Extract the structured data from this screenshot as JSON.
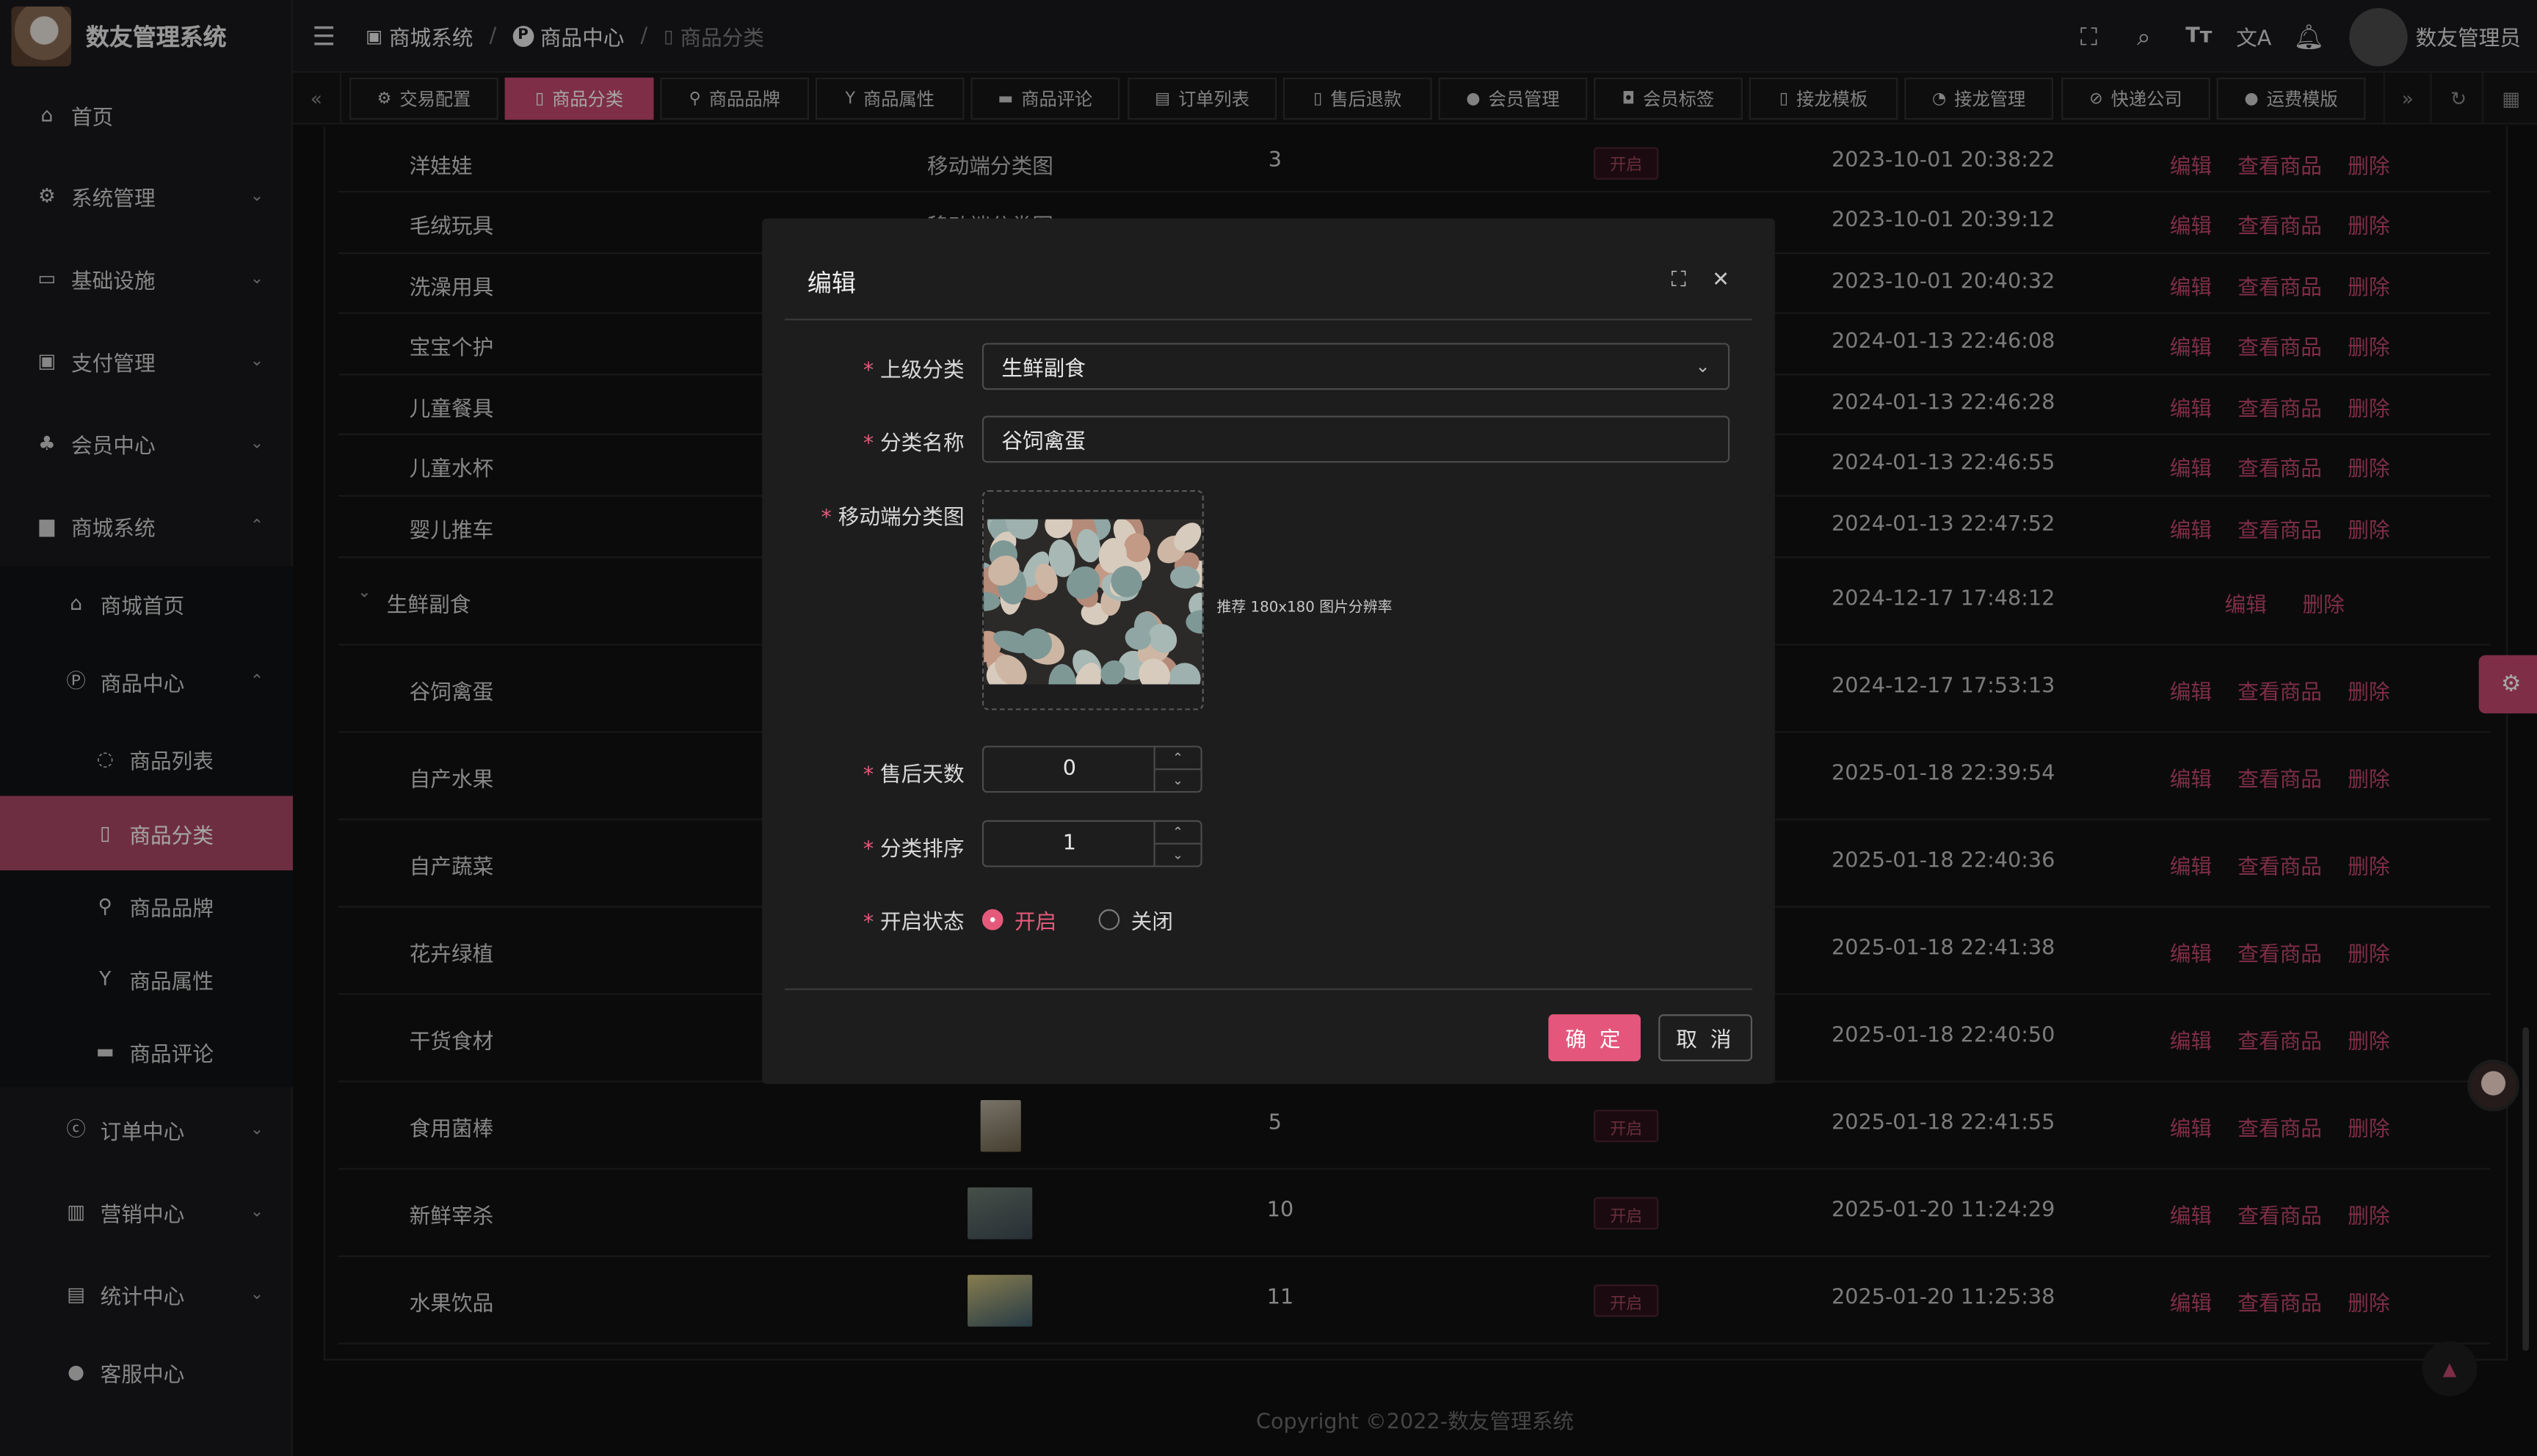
{
  "app": {
    "title": "数友管理系统"
  },
  "sidebar": {
    "items": [
      {
        "label": "首页",
        "icon": "home-icon",
        "arrow": ""
      },
      {
        "label": "系统管理",
        "icon": "gear-icon",
        "arrow": "⌄"
      },
      {
        "label": "基础设施",
        "icon": "monitor-icon",
        "arrow": "⌄"
      },
      {
        "label": "支付管理",
        "icon": "payment-icon",
        "arrow": "⌄"
      },
      {
        "label": "会员中心",
        "icon": "members-icon",
        "arrow": "⌄"
      },
      {
        "label": "商城系统",
        "icon": "shop-icon",
        "arrow": "⌃"
      },
      {
        "label": "商城首页",
        "icon": "home-icon",
        "arrow": ""
      },
      {
        "label": "商品中心",
        "icon": "product-center-icon",
        "arrow": "⌃"
      },
      {
        "label": "商品列表",
        "icon": "list-icon",
        "arrow": ""
      },
      {
        "label": "商品分类",
        "icon": "category-icon",
        "arrow": ""
      },
      {
        "label": "商品品牌",
        "icon": "brand-icon",
        "arrow": ""
      },
      {
        "label": "商品属性",
        "icon": "attribute-icon",
        "arrow": ""
      },
      {
        "label": "商品评论",
        "icon": "comment-icon",
        "arrow": ""
      },
      {
        "label": "订单中心",
        "icon": "order-icon",
        "arrow": "⌄"
      },
      {
        "label": "营销中心",
        "icon": "gift-icon",
        "arrow": "⌄"
      },
      {
        "label": "统计中心",
        "icon": "stats-icon",
        "arrow": "⌄"
      },
      {
        "label": "客服中心",
        "icon": "user-icon",
        "arrow": ""
      }
    ]
  },
  "header": {
    "breadcrumbs": [
      "商城系统",
      "商品中心",
      "商品分类"
    ],
    "separator": "/",
    "username": "数友管理员"
  },
  "tabs": [
    {
      "label": "交易配置"
    },
    {
      "label": "商品分类"
    },
    {
      "label": "商品品牌"
    },
    {
      "label": "商品属性"
    },
    {
      "label": "商品评论"
    },
    {
      "label": "订单列表"
    },
    {
      "label": "售后退款"
    },
    {
      "label": "会员管理"
    },
    {
      "label": "会员标签"
    },
    {
      "label": "接龙模板"
    },
    {
      "label": "接龙管理"
    },
    {
      "label": "快递公司"
    },
    {
      "label": "运费模版"
    }
  ],
  "table": {
    "status_label": "开启",
    "ops": {
      "edit": "编辑",
      "view": "查看商品",
      "delete": "删除"
    },
    "img_alt": "移动端分类图",
    "rows": [
      {
        "name": "洋娃娃",
        "sort": "3",
        "time": "2023-10-01 20:38:22",
        "img": "alt"
      },
      {
        "name": "毛绒玩具",
        "sort": "",
        "time": "2023-10-01 20:39:12",
        "img": "alt"
      },
      {
        "name": "洗澡用具",
        "sort": "",
        "time": "2023-10-01 20:40:32",
        "img": ""
      },
      {
        "name": "宝宝个护",
        "sort": "",
        "time": "2024-01-13 22:46:08",
        "img": ""
      },
      {
        "name": "儿童餐具",
        "sort": "",
        "time": "2024-01-13 22:46:28",
        "img": ""
      },
      {
        "name": "儿童水杯",
        "sort": "",
        "time": "2024-01-13 22:46:55",
        "img": ""
      },
      {
        "name": "婴儿推车",
        "sort": "",
        "time": "2024-01-13 22:47:52",
        "img": ""
      },
      {
        "name": "生鲜副食",
        "sort": "",
        "time": "2024-12-17 17:48:12",
        "img": "",
        "parent": true
      },
      {
        "name": "谷饲禽蛋",
        "sort": "",
        "time": "2024-12-17 17:53:13",
        "img": ""
      },
      {
        "name": "自产水果",
        "sort": "",
        "time": "2025-01-18 22:39:54",
        "img": ""
      },
      {
        "name": "自产蔬菜",
        "sort": "",
        "time": "2025-01-18 22:40:36",
        "img": ""
      },
      {
        "name": "花卉绿植",
        "sort": "",
        "time": "2025-01-18 22:41:38",
        "img": ""
      },
      {
        "name": "干货食材",
        "sort": "",
        "time": "2025-01-18 22:40:50",
        "img": ""
      },
      {
        "name": "食用菌棒",
        "sort": "5",
        "time": "2025-01-18 22:41:55",
        "img": "thumb"
      },
      {
        "name": "新鲜宰杀",
        "sort": "10",
        "time": "2025-01-20 11:24:29",
        "img": "thumb"
      },
      {
        "name": "水果饮品",
        "sort": "11",
        "time": "2025-01-20 11:25:38",
        "img": "thumb"
      }
    ]
  },
  "footer": {
    "text": "Copyright ©2022-数友管理系统"
  },
  "dialog": {
    "title": "编辑",
    "fields": {
      "parent_label": "上级分类",
      "parent_value": "生鲜副食",
      "name_label": "分类名称",
      "name_value": "谷饲禽蛋",
      "image_label": "移动端分类图",
      "image_tip": "推荐 180x180 图片分辨率",
      "after_sale_label": "售后天数",
      "after_sale_value": "0",
      "sort_label": "分类排序",
      "sort_value": "1",
      "status_label": "开启状态",
      "status_on": "开启",
      "status_off": "关闭"
    },
    "required_mark": "*",
    "ok": "确 定",
    "cancel": "取 消"
  },
  "colors": {
    "accent": "#e4567c",
    "active_menu": "#a94866",
    "bg": "#101010"
  }
}
